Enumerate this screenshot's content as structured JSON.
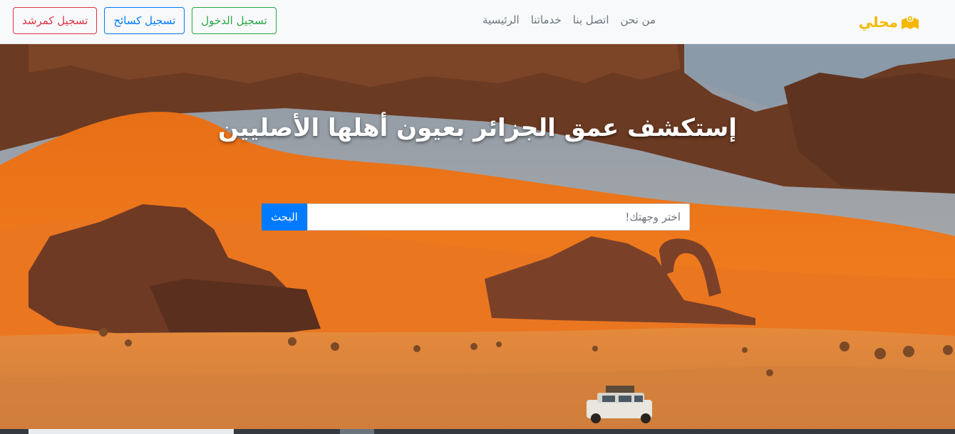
{
  "brand": {
    "name": "محلي",
    "icon": "map-icon",
    "color": "#f5b800"
  },
  "nav": {
    "items": [
      {
        "label": "الرئيسية"
      },
      {
        "label": "خدماتنا"
      },
      {
        "label": "اتصل بنا"
      },
      {
        "label": "من نحن"
      }
    ]
  },
  "auth": {
    "login_label": "تسجيل الدخول",
    "tourist_label": "تسجيل كسائح",
    "guide_label": "تسجيل كمرشد"
  },
  "hero": {
    "title": "إستكشف عمق الجزائر بعيون أهلها الأصليين",
    "search_placeholder": "اختر وجهتك!",
    "search_value": "",
    "search_button": "البحث"
  },
  "colors": {
    "primary": "#007bff",
    "success": "#28a745",
    "danger": "#dc3545"
  }
}
